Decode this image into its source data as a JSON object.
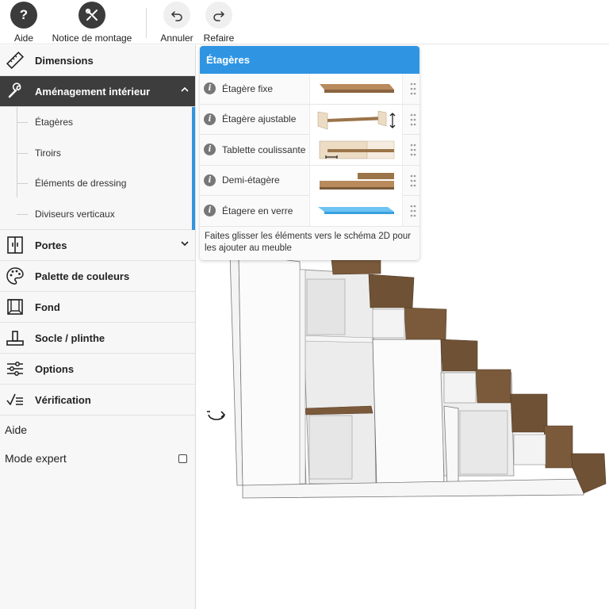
{
  "toolbar": {
    "help_label": "Aide",
    "help_glyph": "?",
    "assembly_label": "Notice de montage",
    "undo_label": "Annuler",
    "redo_label": "Refaire"
  },
  "sidebar": {
    "dimensions": "Dimensions",
    "interior": "Aménagement intérieur",
    "sub_items": [
      "Étagères",
      "Tiroirs",
      "Éléments de dressing",
      "Diviseurs verticaux"
    ],
    "doors": "Portes",
    "palette": "Palette de couleurs",
    "back": "Fond",
    "plinth": "Socle / plinthe",
    "options": "Options",
    "check": "Vérification",
    "help": "Aide",
    "expert_mode": "Mode expert",
    "expert_mode_checked": false
  },
  "popup": {
    "title": "Étagères",
    "items": [
      {
        "label": "Étagère fixe",
        "thumb": "fixed-shelf"
      },
      {
        "label": "Étagère ajustable",
        "thumb": "adjustable-shelf"
      },
      {
        "label": "Tablette coulissante",
        "thumb": "sliding-shelf"
      },
      {
        "label": "Demi-étagère",
        "thumb": "half-shelf"
      },
      {
        "label": "Étagere en verre",
        "thumb": "glass-shelf"
      }
    ],
    "hint": "Faites glisser les éléments vers le schéma 2D pour les ajouter au meuble"
  },
  "colors": {
    "accent": "#2f95e3",
    "active_bg": "#3d3d3d",
    "wood": "#7a5a3b",
    "panel": "#f2f2f2"
  }
}
